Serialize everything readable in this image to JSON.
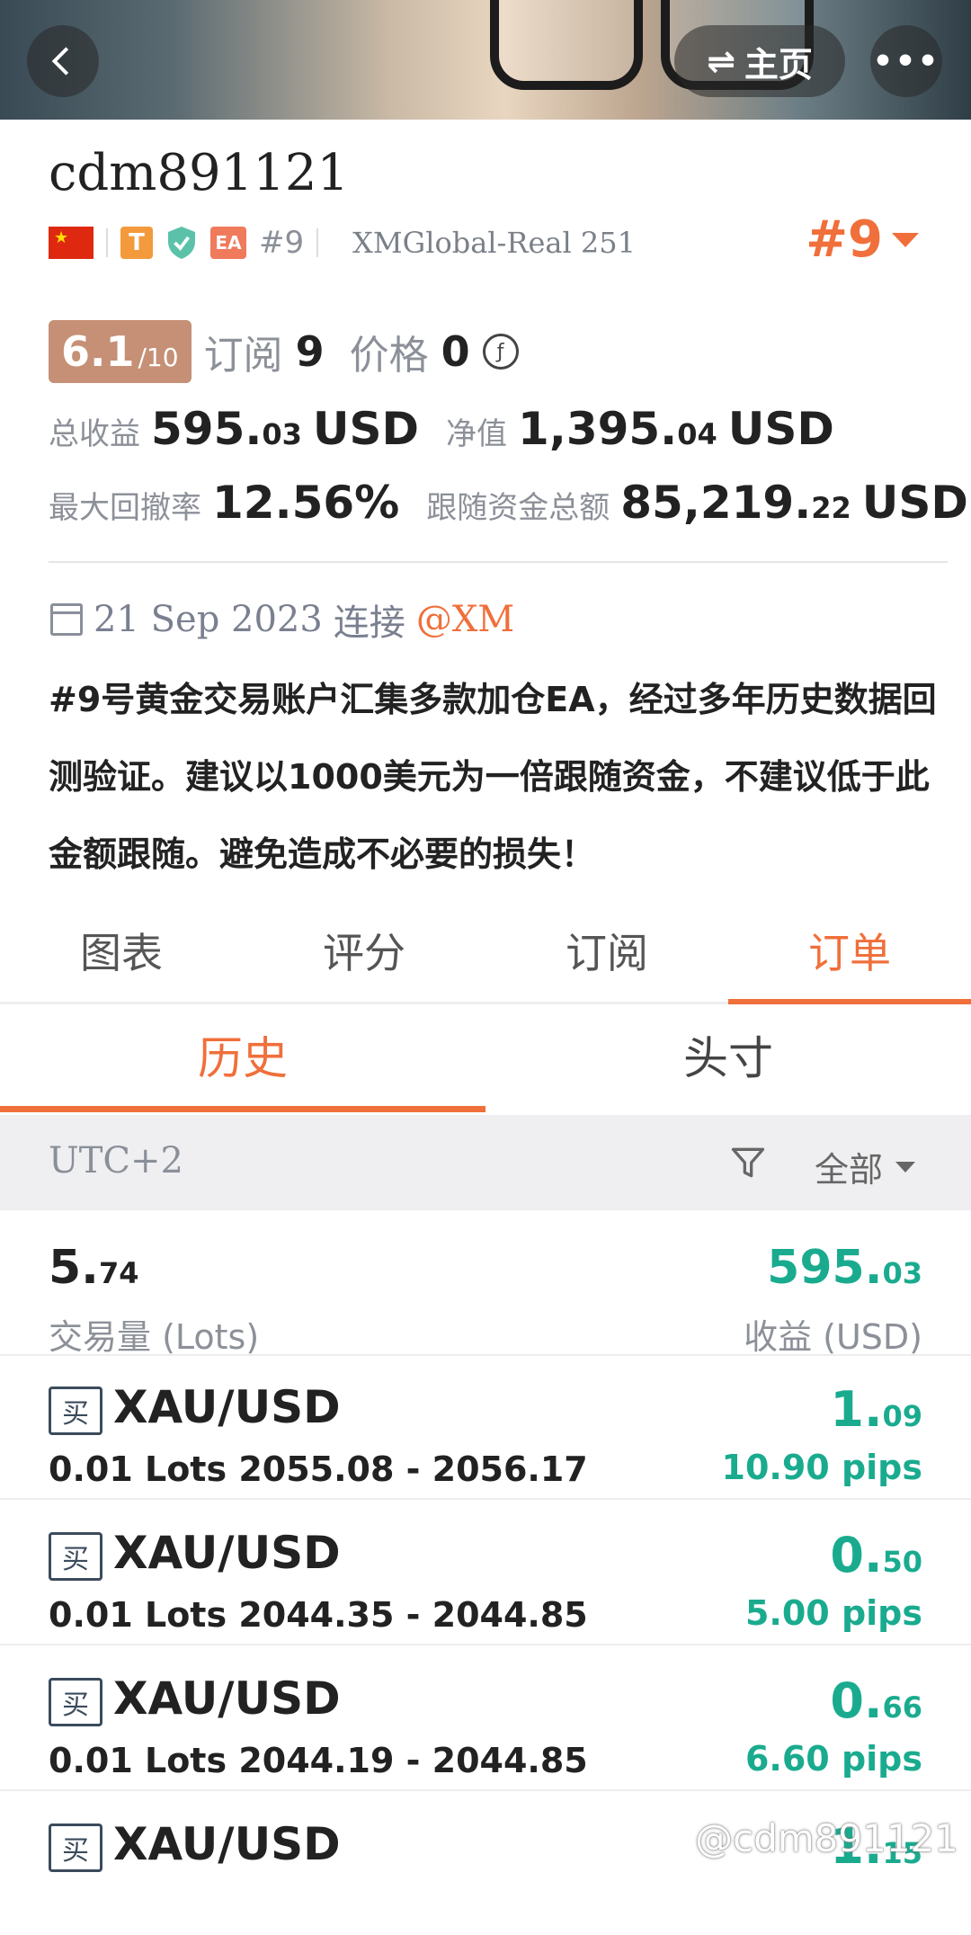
{
  "header": {
    "home_label": "主页",
    "more_label": "•••"
  },
  "profile": {
    "username": "cdm891121",
    "badge_t": "T",
    "badge_ea": "EA",
    "rank_small": "#9",
    "broker": "XMGlobal-Real 251",
    "rank_big": "#9"
  },
  "score": {
    "value": "6.1",
    "out_of": "/10",
    "subscribe_label": "订阅",
    "subscribe_count": "9",
    "price_label": "价格",
    "price_value": "0"
  },
  "stats": {
    "total_profit_label": "总收益",
    "total_profit_int": "595.",
    "total_profit_dec": "03",
    "total_profit_unit": "USD",
    "equity_label": "净值",
    "equity_int": "1,395.",
    "equity_dec": "04",
    "equity_unit": "USD",
    "drawdown_label": "最大回撤率",
    "drawdown_value": "12.56%",
    "follow_funds_label": "跟随资金总额",
    "follow_funds_int": "85,219.",
    "follow_funds_dec": "22",
    "follow_funds_unit": "USD"
  },
  "connect": {
    "date": "21 Sep 2023",
    "text": "连接",
    "mention": "@XM"
  },
  "description": "#9号黄金交易账户汇集多款加仓EA，经过多年历史数据回测验证。建议以1000美元为一倍跟随资金，不建议低于此金额跟随。避免造成不必要的损失！",
  "tabs": [
    "图表",
    "评分",
    "订阅",
    "订单"
  ],
  "subtabs": [
    "历史",
    "头寸"
  ],
  "filter": {
    "timezone": "UTC+2",
    "all_label": "全部"
  },
  "summary": {
    "lots_int": "5.",
    "lots_dec": "74",
    "lots_label": "交易量 (Lots)",
    "profit_int": "595.",
    "profit_dec": "03",
    "profit_label": "收益 (USD)"
  },
  "orders": [
    {
      "side": "买",
      "symbol": "XAU/USD",
      "details": "0.01 Lots 2055.08 - 2056.17",
      "profit_int": "1.",
      "profit_dec": "09",
      "pips": "10.90 pips"
    },
    {
      "side": "买",
      "symbol": "XAU/USD",
      "details": "0.01 Lots 2044.35 - 2044.85",
      "profit_int": "0.",
      "profit_dec": "50",
      "pips": "5.00 pips"
    },
    {
      "side": "买",
      "symbol": "XAU/USD",
      "details": "0.01 Lots 2044.19 - 2044.85",
      "profit_int": "0.",
      "profit_dec": "66",
      "pips": "6.60 pips"
    },
    {
      "side": "买",
      "symbol": "XAU/USD",
      "details": "",
      "profit_int": "1.",
      "profit_dec": "15",
      "pips": ""
    }
  ],
  "watermark": "@cdm891121",
  "colors": {
    "accent": "#f06f3b",
    "profit_green": "#1aab8f",
    "score_bg": "#c59075"
  }
}
